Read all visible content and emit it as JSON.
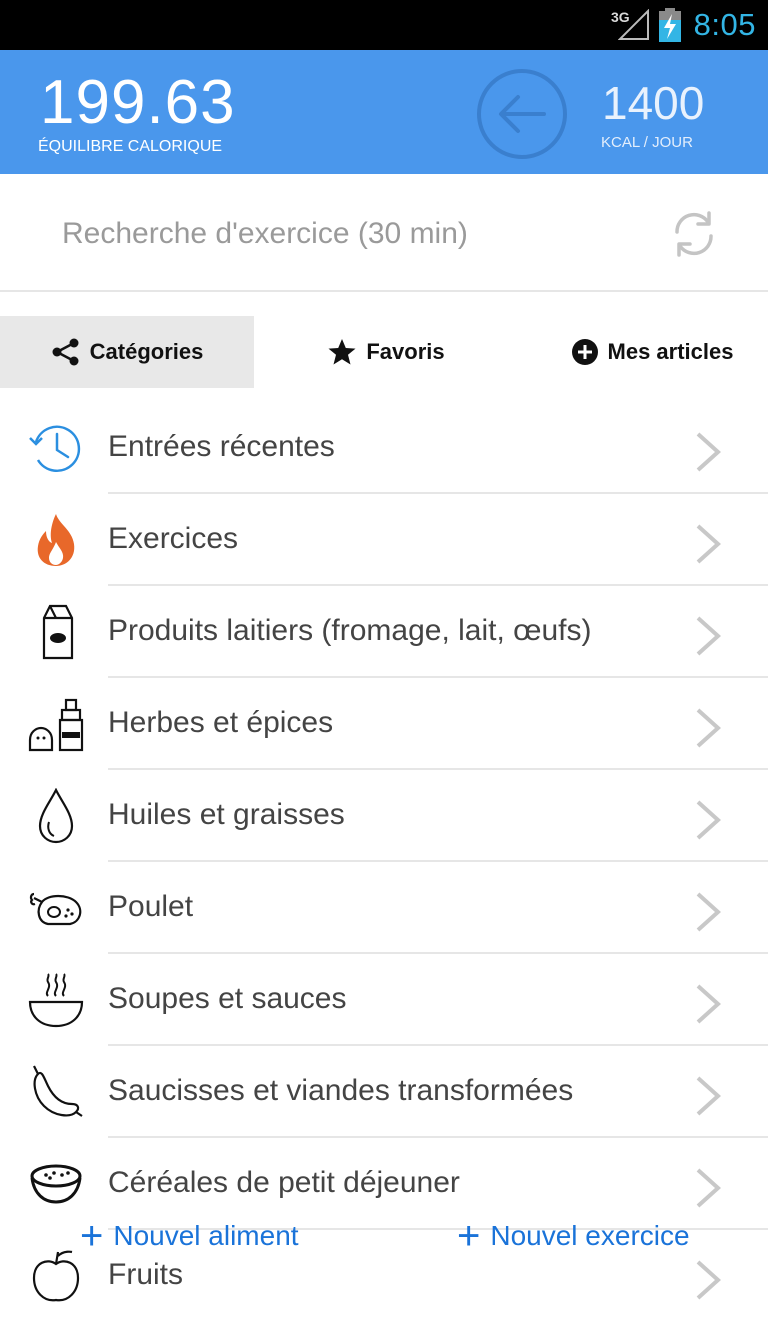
{
  "status_bar": {
    "network": "3G",
    "time": "8:05",
    "time_color": "#33b5e5"
  },
  "header": {
    "balance_value": "199.63",
    "balance_label": "ÉQUILIBRE CALORIQUE",
    "goal_value": "1400",
    "goal_label": "KCAL / JOUR",
    "background": "#4a97ec",
    "back_icon": "arrow-left-circle-icon"
  },
  "search": {
    "placeholder": "Recherche d'exercice (30 min)",
    "value": "",
    "refresh_icon": "refresh-icon"
  },
  "tabs": [
    {
      "label": "Catégories",
      "icon": "share-icon",
      "active": true
    },
    {
      "label": "Favoris",
      "icon": "star-icon",
      "active": false
    },
    {
      "label": "Mes articles",
      "icon": "plus-circle-icon",
      "active": false
    }
  ],
  "categories": [
    {
      "label": "Entrées récentes",
      "icon": "history-clock-icon"
    },
    {
      "label": "Exercices",
      "icon": "flame-icon"
    },
    {
      "label": "Produits laitiers (fromage, lait, œufs)",
      "icon": "milk-carton-icon"
    },
    {
      "label": "Herbes et épices",
      "icon": "salt-pepper-icon"
    },
    {
      "label": "Huiles et graisses",
      "icon": "oil-drop-icon"
    },
    {
      "label": "Poulet",
      "icon": "roast-chicken-icon"
    },
    {
      "label": "Soupes et sauces",
      "icon": "soup-bowl-icon"
    },
    {
      "label": "Saucisses et viandes transformées",
      "icon": "sausage-icon"
    },
    {
      "label": "Céréales de petit déjeuner",
      "icon": "cereal-bowl-icon"
    },
    {
      "label": "Fruits",
      "icon": "apple-icon"
    }
  ],
  "actions": {
    "new_food": "Nouvel aliment",
    "new_exercise": "Nouvel exercice",
    "accent": "#1a73d9"
  }
}
